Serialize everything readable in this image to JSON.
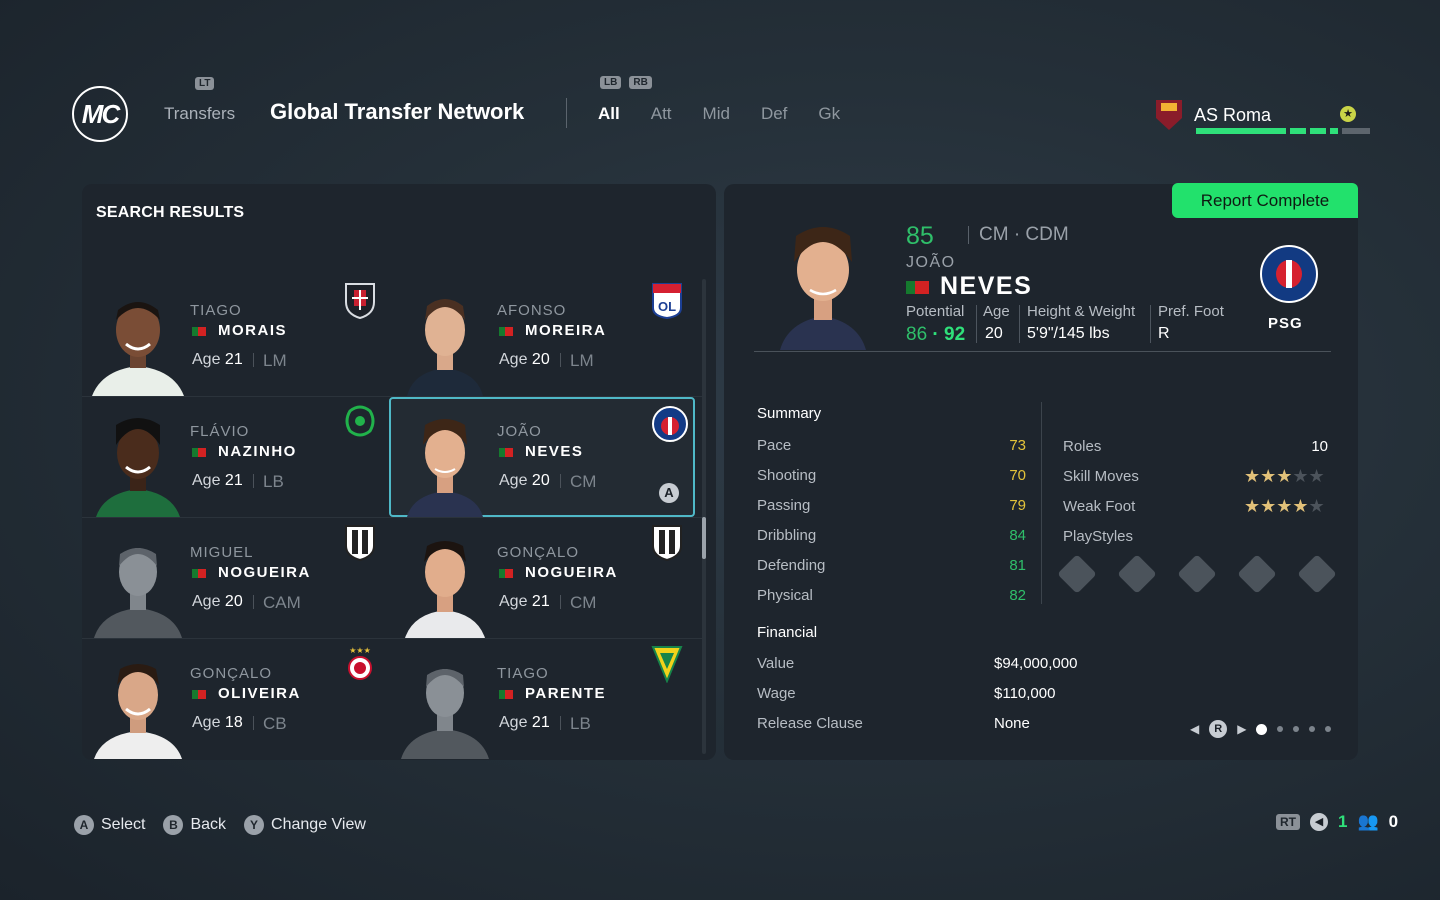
{
  "header": {
    "logo_text": "MC",
    "transfers_hint": "LT",
    "transfers_label": "Transfers",
    "title": "Global Transfer Network",
    "tab_hints": [
      "LB",
      "RB"
    ],
    "tabs": [
      "All",
      "Att",
      "Mid",
      "Def",
      "Gk"
    ],
    "active_tab": "All",
    "club": "AS Roma",
    "reputation_segments": [
      1,
      1,
      1,
      1,
      0
    ]
  },
  "search": {
    "title": "SEARCH RESULTS",
    "players": [
      {
        "first": "TIAGO",
        "last": "MORAIS",
        "age_label": "Age",
        "age": "21",
        "pos": "LM",
        "club_icon": "club-crest-icon"
      },
      {
        "first": "AFONSO",
        "last": "MOREIRA",
        "age_label": "Age",
        "age": "20",
        "pos": "LM",
        "club_icon": "lyon-crest-icon"
      },
      {
        "first": "FLÁVIO",
        "last": "NAZINHO",
        "age_label": "Age",
        "age": "21",
        "pos": "LB",
        "club_icon": "sporting-crest-icon"
      },
      {
        "first": "JOÃO",
        "last": "NEVES",
        "age_label": "Age",
        "age": "20",
        "pos": "CM",
        "club_icon": "psg-crest-icon",
        "selected": true
      },
      {
        "first": "MIGUEL",
        "last": "NOGUEIRA",
        "age_label": "Age",
        "age": "20",
        "pos": "CAM",
        "club_icon": "guimaraes-crest-icon"
      },
      {
        "first": "GONÇALO",
        "last": "NOGUEIRA",
        "age_label": "Age",
        "age": "21",
        "pos": "CM",
        "club_icon": "guimaraes-crest-icon"
      },
      {
        "first": "GONÇALO",
        "last": "OLIVEIRA",
        "age_label": "Age",
        "age": "18",
        "pos": "CB",
        "club_icon": "benfica-crest-icon"
      },
      {
        "first": "TIAGO",
        "last": "PARENTE",
        "age_label": "Age",
        "age": "21",
        "pos": "LB",
        "club_icon": "estoril-crest-icon"
      }
    ],
    "selected_marker": "A"
  },
  "detail": {
    "report_button": "Report Complete",
    "overall": "85",
    "positions": "CM · CDM",
    "first": "JOÃO",
    "last": "NEVES",
    "potential_label": "Potential",
    "potential_low": "86",
    "potential_sep": "·",
    "potential_high": "92",
    "age_label": "Age",
    "age": "20",
    "hw_label": "Height & Weight",
    "hw": "5'9\"/145 lbs",
    "foot_label": "Pref. Foot",
    "foot": "R",
    "club": "PSG",
    "summary_title": "Summary",
    "stats": [
      {
        "label": "Pace",
        "value": "73"
      },
      {
        "label": "Shooting",
        "value": "70"
      },
      {
        "label": "Passing",
        "value": "79"
      },
      {
        "label": "Dribbling",
        "value": "84"
      },
      {
        "label": "Defending",
        "value": "81"
      },
      {
        "label": "Physical",
        "value": "82"
      }
    ],
    "roles_label": "Roles",
    "roles": "10",
    "skill_label": "Skill Moves",
    "skill_stars": 3,
    "weak_label": "Weak Foot",
    "weak_stars": 4,
    "playstyles_label": "PlayStyles",
    "financial_title": "Financial",
    "value_label": "Value",
    "value": "$94,000,000",
    "wage_label": "Wage",
    "wage": "$110,000",
    "release_label": "Release Clause",
    "release": "None",
    "pager_button": "R",
    "pages": 5,
    "page": 1
  },
  "footer": {
    "actions": [
      {
        "button": "A",
        "label": "Select"
      },
      {
        "button": "B",
        "label": "Back"
      },
      {
        "button": "Y",
        "label": "Change View"
      }
    ],
    "rt_hint": "RT",
    "count1": "1",
    "count2": "0"
  },
  "colors": {
    "accent_green": "#22e16c",
    "select_outline": "#4fb8c7",
    "stat_yellow": "#e3c33a",
    "stat_green": "#2fbf6a"
  }
}
